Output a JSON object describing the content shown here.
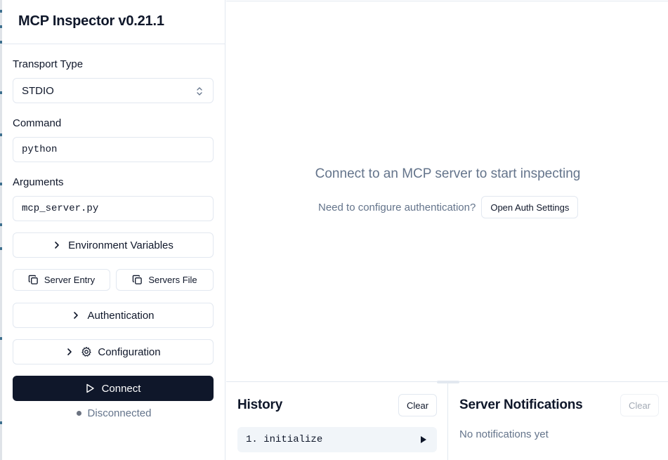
{
  "sidebar": {
    "title": "MCP Inspector v0.21.1",
    "transport": {
      "label": "Transport Type",
      "value": "STDIO"
    },
    "command": {
      "label": "Command",
      "value": "python"
    },
    "arguments": {
      "label": "Arguments",
      "value": "mcp_server.py"
    },
    "env_vars_label": "Environment Variables",
    "server_entry_label": "Server Entry",
    "servers_file_label": "Servers File",
    "authentication_label": "Authentication",
    "configuration_label": "Configuration",
    "connect_label": "Connect",
    "status_label": "Disconnected"
  },
  "main": {
    "empty_message": "Connect to an MCP server to start inspecting",
    "auth_prompt": "Need to configure authentication?",
    "auth_button": "Open Auth Settings"
  },
  "history": {
    "title": "History",
    "clear_label": "Clear",
    "items": [
      {
        "label": "1. initialize"
      }
    ]
  },
  "notifications": {
    "title": "Server Notifications",
    "clear_label": "Clear",
    "empty_text": "No notifications yet"
  },
  "colors": {
    "primary": "#0f172a",
    "muted_text": "#64748b",
    "border": "#e2e8f0",
    "status_dot": "#6b7280"
  }
}
